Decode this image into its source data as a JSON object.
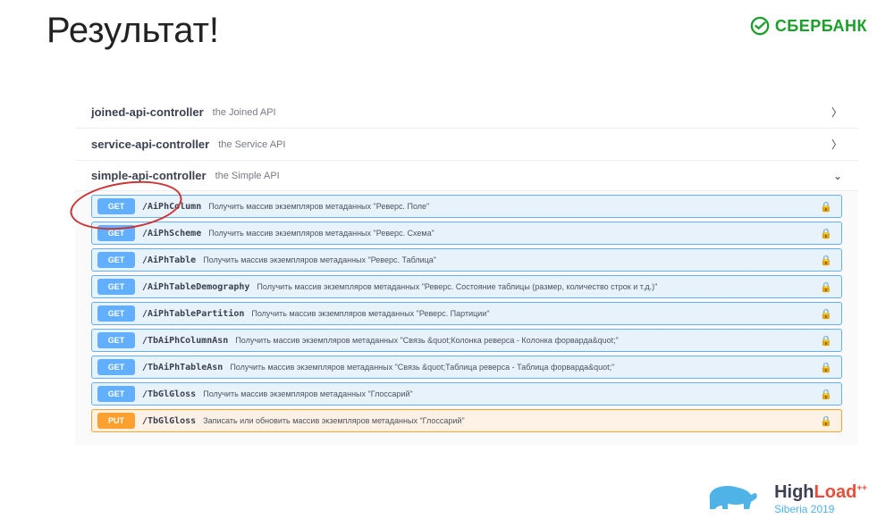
{
  "title": "Результат!",
  "logo": {
    "text": "СБЕРБАНК"
  },
  "controllers": [
    {
      "name": "joined-api-controller",
      "desc": "the Joined API",
      "expanded": false
    },
    {
      "name": "service-api-controller",
      "desc": "the Service API",
      "expanded": false
    },
    {
      "name": "simple-api-controller",
      "desc": "the Simple API",
      "expanded": true
    }
  ],
  "endpoints": [
    {
      "method": "GET",
      "path": "/AiPhColumn",
      "desc": "Получить массив экземпляров метаданных \"Реверс. Поле\""
    },
    {
      "method": "GET",
      "path": "/AiPhScheme",
      "desc": "Получить массив экземпляров метаданных \"Реверс. Схема\""
    },
    {
      "method": "GET",
      "path": "/AiPhTable",
      "desc": "Получить массив экземпляров метаданных \"Реверс. Таблица\""
    },
    {
      "method": "GET",
      "path": "/AiPhTableDemography",
      "desc": "Получить массив экземпляров метаданных \"Реверс. Состояние таблицы (размер, количество строк и т.д.)\""
    },
    {
      "method": "GET",
      "path": "/AiPhTablePartition",
      "desc": "Получить массив экземпляров метаданных \"Реверс. Партиции\""
    },
    {
      "method": "GET",
      "path": "/TbAiPhColumnAsn",
      "desc": "Получить массив экземпляров метаданных \"Связь &quot;Колонка реверса - Колонка форварда&quot;\""
    },
    {
      "method": "GET",
      "path": "/TbAiPhTableAsn",
      "desc": "Получить массив экземпляров метаданных \"Связь &quot;Таблица реверса - Таблица форварда&quot;\""
    },
    {
      "method": "GET",
      "path": "/TbGlGloss",
      "desc": "Получить массив экземпляров метаданных \"Глоссарий\""
    },
    {
      "method": "PUT",
      "path": "/TbGlGloss",
      "desc": "Записать или обновить массив экземпляров метаданных \"Глоссарий\""
    }
  ],
  "footer": {
    "high": "High",
    "load": "Load",
    "plus": "++",
    "sub": "Siberia 2019"
  }
}
